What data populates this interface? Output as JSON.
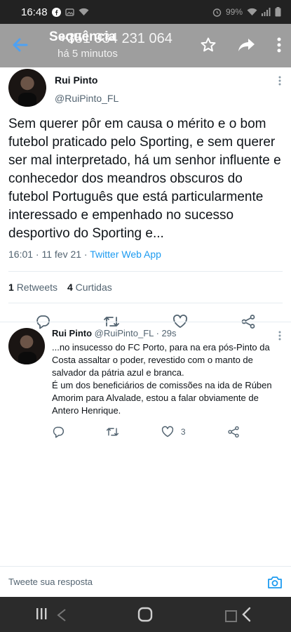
{
  "status_bar": {
    "time": "16:48",
    "battery": "99%"
  },
  "app_bar": {
    "title": "Sequência",
    "overlay_phone": "+351 934 231 064",
    "subtitle": "há 5 minutos",
    "icons": [
      "back-arrow-icon",
      "star-icon",
      "share-forward-icon",
      "more-vertical-icon"
    ]
  },
  "main_tweet": {
    "author_name": "Rui Pinto",
    "author_handle": "@RuiPinto_FL",
    "text": "Sem querer pôr em causa o mérito e o bom futebol praticado pelo Sporting, e sem querer ser mal interpretado, há um senhor influente e conhecedor dos meandros obscuros do futebol Português que está particularmente interessado e empenhado no sucesso desportivo do Sporting e...",
    "timestamp": "16:01 · 11 fev 21",
    "source_separator": " · ",
    "source": "Twitter Web App",
    "retweets_count": "1",
    "retweets_label": "Retweets",
    "likes_count": "4",
    "likes_label": "Curtidas"
  },
  "reply_tweet": {
    "author_name": "Rui Pinto",
    "author_handle": "@RuiPinto_FL",
    "time": "· 29s",
    "text_line1": "...no insucesso do FC Porto, para na era pós-Pinto da Costa assaltar o poder, revestido com o manto de salvador da pátria azul e branca.",
    "text_line2": "É um dos beneficiários de comissões na ida de Rúben Amorim para Alvalade, estou a falar obviamente de Antero Henrique.",
    "likes_count": "3"
  },
  "compose": {
    "placeholder": "Tweete sua resposta"
  },
  "colors": {
    "link": "#1d9bf0",
    "secondary_text": "#536471",
    "app_bar": "#9e9e9e"
  }
}
